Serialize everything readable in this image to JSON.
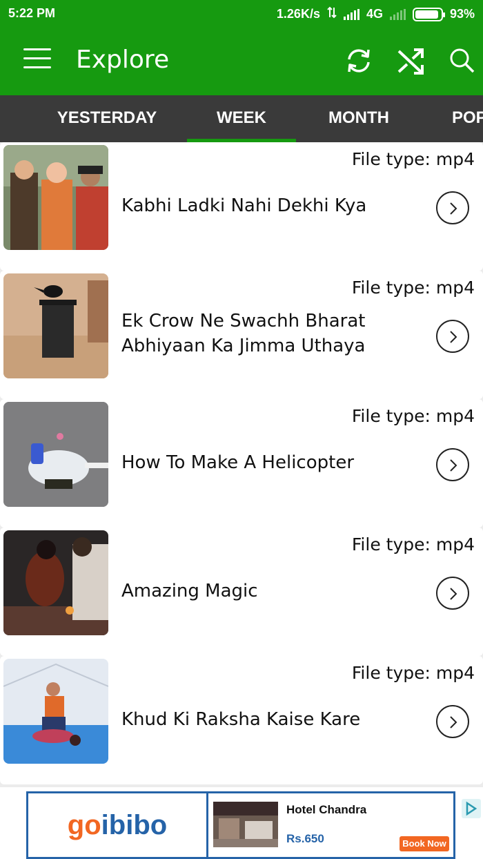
{
  "status_bar": {
    "time": "5:22 PM",
    "net_speed": "1.26K/s",
    "network": "4G",
    "battery": "93%",
    "battery_level": 0.93
  },
  "app_bar": {
    "title": "Explore",
    "icons": [
      "menu-icon",
      "refresh-icon",
      "shuffle-icon",
      "search-icon"
    ]
  },
  "tabs": [
    {
      "label": "YESTERDAY",
      "active": false
    },
    {
      "label": "WEEK",
      "active": true
    },
    {
      "label": "MONTH",
      "active": false
    },
    {
      "label": "POPULAR",
      "active": false
    }
  ],
  "videos": [
    {
      "file_type": "File type: mp4",
      "title": "Kabhi Ladki Nahi Dekhi Kya"
    },
    {
      "file_type": "File type: mp4",
      "title": "Ek Crow Ne Swachh Bharat Abhiyaan Ka Jimma Uthaya"
    },
    {
      "file_type": "File type: mp4",
      "title": "How To Make A Helicopter"
    },
    {
      "file_type": "File type: mp4",
      "title": "Amazing Magic"
    },
    {
      "file_type": "File type: mp4",
      "title": "Khud Ki Raksha Kaise Kare"
    }
  ],
  "ad": {
    "logo_text": "goibibo",
    "hotel": "Hotel Chandra",
    "price": "Rs.650",
    "cta": "Book Now"
  },
  "colors": {
    "primary": "#169a10",
    "tab_bar": "#3a3a3a",
    "ad_border": "#2563a8",
    "ad_cta": "#f26722"
  }
}
